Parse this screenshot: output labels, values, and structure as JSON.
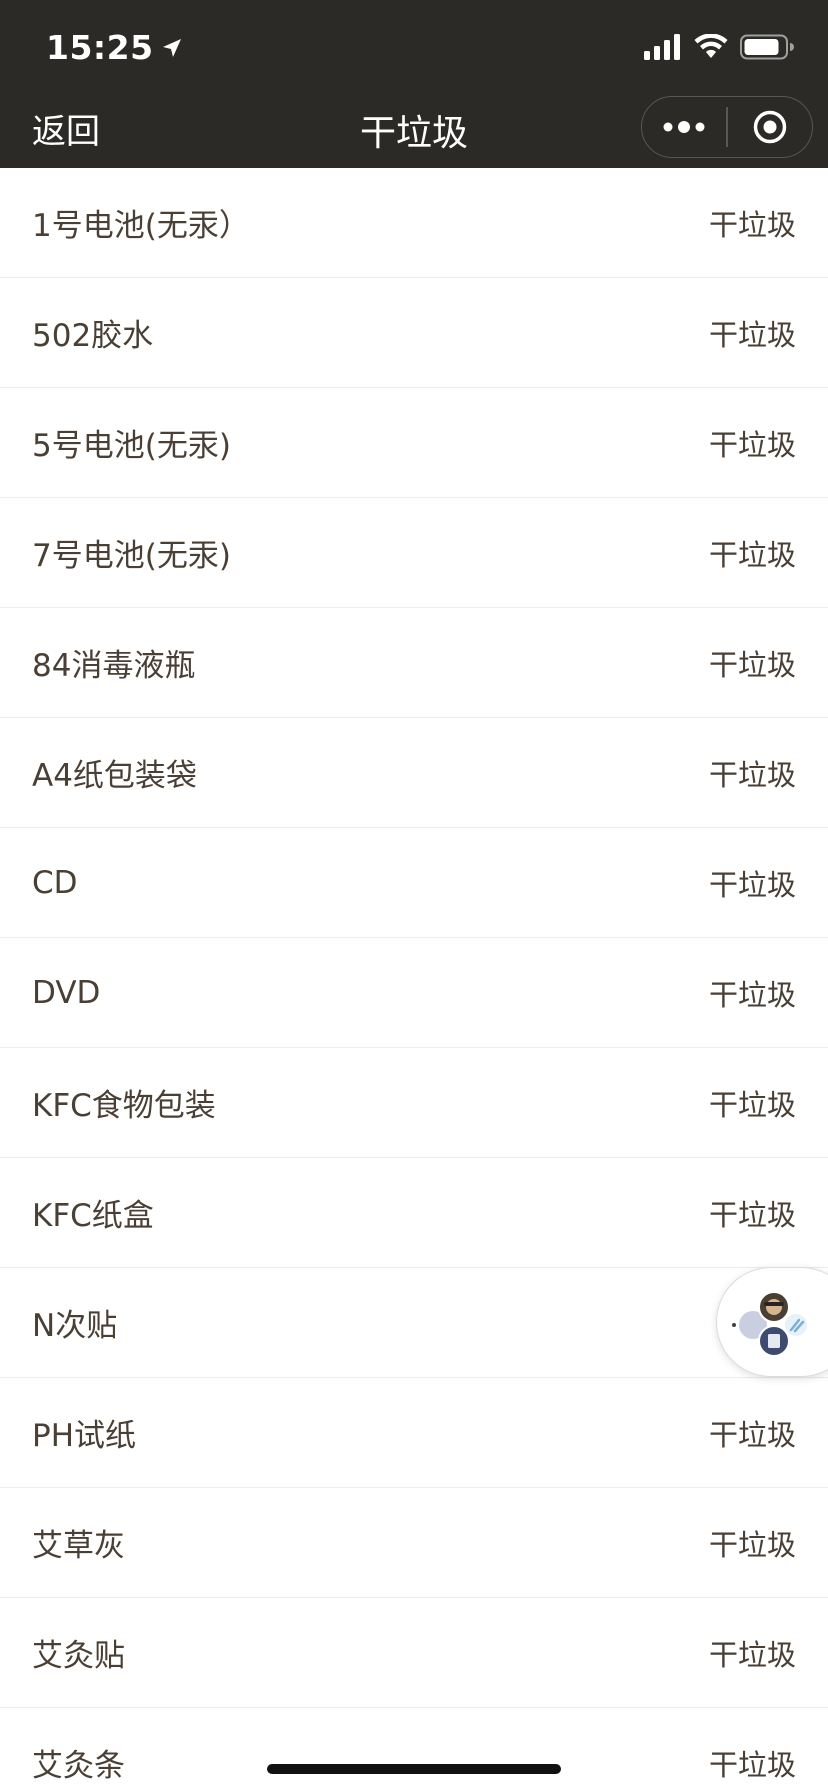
{
  "status_bar": {
    "time": "15:25",
    "icons": [
      "location-arrow-icon",
      "signal-icon",
      "wifi-icon",
      "battery-icon"
    ]
  },
  "nav": {
    "back_label": "返回",
    "title": "干垃圾",
    "capsule_icons": [
      "more-dots-icon",
      "close-target-icon"
    ]
  },
  "colors": {
    "header_bg": "#2c2a26",
    "text": "#4a3f35",
    "divider": "#ececec"
  },
  "list": {
    "items": [
      {
        "name": "1号电池(无汞）",
        "category": "干垃圾"
      },
      {
        "name": "502胶水",
        "category": "干垃圾"
      },
      {
        "name": "5号电池(无汞)",
        "category": "干垃圾"
      },
      {
        "name": "7号电池(无汞)",
        "category": "干垃圾"
      },
      {
        "name": "84消毒液瓶",
        "category": "干垃圾"
      },
      {
        "name": "A4纸包装袋",
        "category": "干垃圾"
      },
      {
        "name": "CD",
        "category": "干垃圾"
      },
      {
        "name": "DVD",
        "category": "干垃圾"
      },
      {
        "name": "KFC食物包装",
        "category": "干垃圾"
      },
      {
        "name": "KFC纸盒",
        "category": "干垃圾"
      },
      {
        "name": "N次贴",
        "category": ""
      },
      {
        "name": "PH试纸",
        "category": "干垃圾"
      },
      {
        "name": "艾草灰",
        "category": "干垃圾"
      },
      {
        "name": "艾灸贴",
        "category": "干垃圾"
      },
      {
        "name": "艾灸条",
        "category": "干垃圾"
      }
    ]
  },
  "floating_bubble": {
    "icon": "avatar-group-icon"
  }
}
